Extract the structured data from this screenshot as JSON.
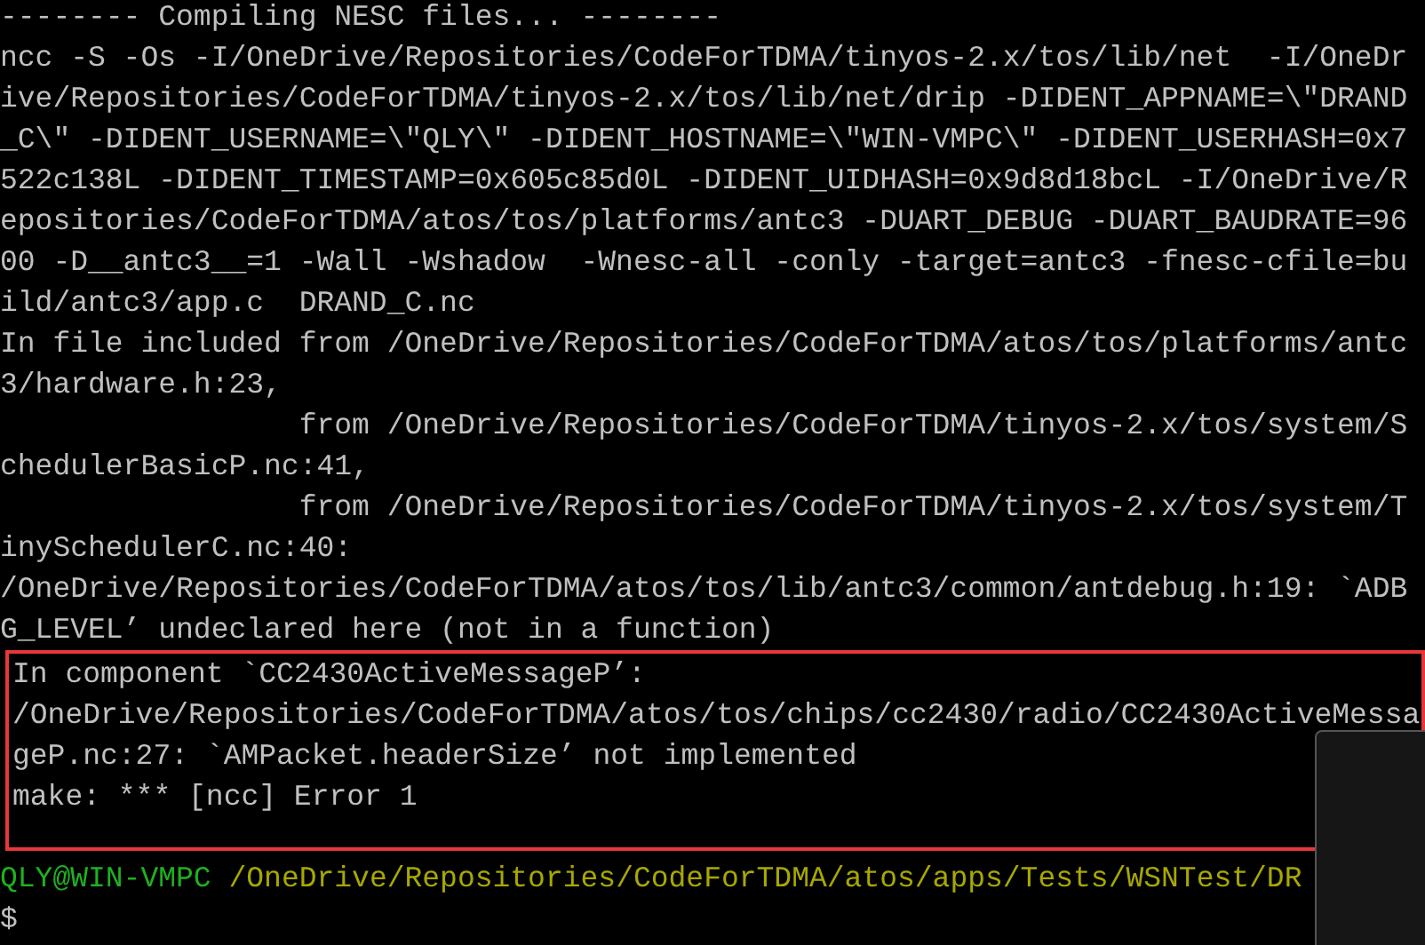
{
  "terminal": {
    "lines": [
      {
        "kind": "output",
        "text": "-------- Compiling NESC files... --------",
        "highlighted": false
      },
      {
        "kind": "output",
        "text": "ncc -S -Os -I/OneDrive/Repositories/CodeForTDMA/tinyos-2.x/tos/lib/net  -I/OneDr",
        "highlighted": false
      },
      {
        "kind": "output",
        "text": "ive/Repositories/CodeForTDMA/tinyos-2.x/tos/lib/net/drip -DIDENT_APPNAME=\\\"DRAND",
        "highlighted": false
      },
      {
        "kind": "output",
        "text": "_C\\\" -DIDENT_USERNAME=\\\"QLY\\\" -DIDENT_HOSTNAME=\\\"WIN-VMPC\\\" -DIDENT_USERHASH=0x7",
        "highlighted": false
      },
      {
        "kind": "output",
        "text": "522c138L -DIDENT_TIMESTAMP=0x605c85d0L -DIDENT_UIDHASH=0x9d8d18bcL -I/OneDrive/R",
        "highlighted": false
      },
      {
        "kind": "output",
        "text": "epositories/CodeForTDMA/atos/tos/platforms/antc3 -DUART_DEBUG -DUART_BAUDRATE=96",
        "highlighted": false
      },
      {
        "kind": "output",
        "text": "00 -D__antc3__=1 -Wall -Wshadow  -Wnesc-all -conly -target=antc3 -fnesc-cfile=bu",
        "highlighted": false
      },
      {
        "kind": "output",
        "text": "ild/antc3/app.c  DRAND_C.nc",
        "highlighted": false
      },
      {
        "kind": "output",
        "text": "In file included from /OneDrive/Repositories/CodeForTDMA/atos/tos/platforms/antc",
        "highlighted": false
      },
      {
        "kind": "output",
        "text": "3/hardware.h:23,",
        "highlighted": false
      },
      {
        "kind": "output",
        "text": "                 from /OneDrive/Repositories/CodeForTDMA/tinyos-2.x/tos/system/S",
        "highlighted": false
      },
      {
        "kind": "output",
        "text": "chedulerBasicP.nc:41,",
        "highlighted": false
      },
      {
        "kind": "output",
        "text": "                 from /OneDrive/Repositories/CodeForTDMA/tinyos-2.x/tos/system/T",
        "highlighted": false
      },
      {
        "kind": "output",
        "text": "inySchedulerC.nc:40:",
        "highlighted": false
      },
      {
        "kind": "output",
        "text": "/OneDrive/Repositories/CodeForTDMA/atos/tos/lib/antc3/common/antdebug.h:19: `ADB",
        "highlighted": false
      },
      {
        "kind": "output",
        "text": "G_LEVEL’ undeclared here (not in a function)",
        "highlighted": false
      },
      {
        "kind": "output",
        "text": "In component `CC2430ActiveMessageP’:",
        "highlighted": true
      },
      {
        "kind": "output",
        "text": "/OneDrive/Repositories/CodeForTDMA/atos/tos/chips/cc2430/radio/CC2430ActiveMessa",
        "highlighted": true
      },
      {
        "kind": "output",
        "text": "geP.nc:27: `AMPacket.headerSize’ not implemented",
        "highlighted": true
      },
      {
        "kind": "output",
        "text": "make: *** [ncc] Error 1",
        "highlighted": true
      },
      {
        "kind": "prompt",
        "user": "QLY@WIN-VMPC",
        "path": "/OneDrive/Repositories/CodeForTDMA/atos/apps/Tests/WSNTest/DR",
        "highlighted": false
      },
      {
        "kind": "output",
        "text": "$",
        "highlighted": false
      }
    ]
  }
}
